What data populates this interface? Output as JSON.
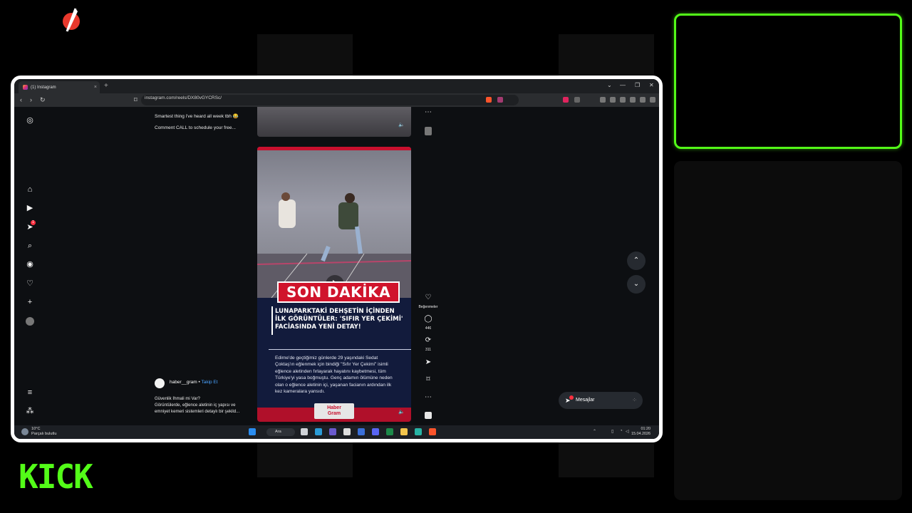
{
  "overlay": {
    "kick_logo": "KICK"
  },
  "browser": {
    "tab_title": "(1) Instagram",
    "url": "instagram.com/reels/DX80vGYCRSc/",
    "new_tab": "+",
    "tab_close": "×",
    "window_controls": [
      "⌄",
      "—",
      "❐",
      "✕"
    ]
  },
  "colors": {
    "kick_green": "#53fc18",
    "son_dakika_red": "#d0142c",
    "instagram_notification": "#ff3040",
    "reel_background": "#121b3c"
  },
  "instagram": {
    "sidebar_icons": [
      "instagram-icon",
      "home-icon",
      "reels-icon",
      "send-icon",
      "search-icon",
      "explore-icon",
      "heart-icon",
      "plus-icon",
      "avatar",
      "menu-icon",
      "more-icon"
    ],
    "send_badge": "1",
    "prev_caption": {
      "line1": "Smartest thing i've heard all week tbh 😂",
      "line2": "Comment CALL to schedule your free..."
    },
    "reel": {
      "son_dakika": "SON DAKİKA",
      "headline": "LUNAPARKTAKİ DEHŞETİN İÇİNDEN İLK GÖRÜNTÜLER: 'SIFIR YER ÇEKİMİ' FACİASINDA YENİ DETAY!",
      "body": "Edirne'de geçtiğimiz günlerde 29 yaşındaki Sedat Çoktaş'ın eğlenmek için bindiği \"Sıfır Yer Çekimi\" isimli eğlence aletinden fırlayarak hayatını kaybetmesi, tüm Türkiye'yi yasa boğmuştu. Genç adamın ölümüne neden olan o eğlence aletinin içi, yaşanan facianın ardından ilk kez kameralara yansıdı.",
      "logo_line1": "Haber",
      "logo_line2": "Gram"
    },
    "actions": {
      "likes_label": "Beğenmeler",
      "comments": "446",
      "reposts": "311"
    },
    "author": {
      "name": "haber__gram",
      "separator": " • ",
      "follow": "Takip Et",
      "desc_line1": "Güvenlik İhmali mi Var?",
      "desc_line2": "Görüntülerde, eğlence aletinin iç yapısı ve",
      "desc_line3": "emniyet kemeri sistemleri detaylı bir şekild..."
    },
    "messages_label": "Mesajlar",
    "messages_badge": "1"
  },
  "taskbar": {
    "temperature": "10°C",
    "weather_text": "Parçalı bulutlu",
    "search_label": "Ara",
    "time": "01:20",
    "date": "15.04.2026"
  }
}
